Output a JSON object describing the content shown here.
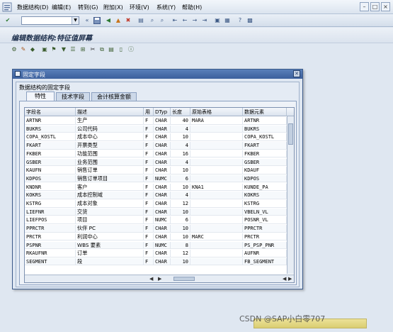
{
  "menubar": {
    "items": [
      "数据结构(D)",
      "编辑(E)",
      "转到(G)",
      "附加(X)",
      "环境(V)",
      "系统(Y)",
      "帮助(H)"
    ]
  },
  "page": {
    "title": "编辑数据结构:特征值屏幕"
  },
  "dialog": {
    "title": "固定字段",
    "group_label": "数据结构的固定字段",
    "tabs": [
      "特性",
      "技术字段",
      "会计核算金额"
    ],
    "table": {
      "headers": [
        "字段名",
        "描述",
        "用",
        "DTyp",
        "长度",
        "原始表格",
        "数据元素"
      ],
      "rows": [
        [
          "ARTNR",
          "生产",
          "F",
          "CHAR",
          "40",
          "MARA",
          "ARTNR"
        ],
        [
          "BUKRS",
          "公司代码",
          "F",
          "CHAR",
          "4",
          "",
          "BUKRS"
        ],
        [
          "COPA_KOSTL",
          "成本中心",
          "F",
          "CHAR",
          "10",
          "",
          "COPA_KOSTL"
        ],
        [
          "FKART",
          "开票类型",
          "F",
          "CHAR",
          "4",
          "",
          "FKART"
        ],
        [
          "FKBER",
          "功能范围",
          "F",
          "CHAR",
          "16",
          "",
          "FKBER"
        ],
        [
          "GSBER",
          "业务范围",
          "F",
          "CHAR",
          "4",
          "",
          "GSBER"
        ],
        [
          "KAUFN",
          "销售订单",
          "F",
          "CHAR",
          "10",
          "",
          "KDAUF"
        ],
        [
          "KDPOS",
          "销售订单项目",
          "F",
          "NUMC",
          "6",
          "",
          "KDPOS"
        ],
        [
          "KNDNR",
          "客户",
          "F",
          "CHAR",
          "10",
          "KNA1",
          "KUNDE_PA"
        ],
        [
          "KOKRS",
          "成本控制域",
          "F",
          "CHAR",
          "4",
          "",
          "KOKRS"
        ],
        [
          "KSTRG",
          "成本对象",
          "F",
          "CHAR",
          "12",
          "",
          "KSTRG"
        ],
        [
          "LIEFNR",
          "交货",
          "F",
          "CHAR",
          "10",
          "",
          "VBELN_VL"
        ],
        [
          "LIEFPOS",
          "项目",
          "F",
          "NUMC",
          "6",
          "",
          "POSNR_VL"
        ],
        [
          "PPRCTR",
          "伙伴 PC",
          "F",
          "CHAR",
          "10",
          "",
          "PPRCTR"
        ],
        [
          "PRCTR",
          "利润中心",
          "F",
          "CHAR",
          "10",
          "MARC",
          "PRCTR"
        ],
        [
          "PSPNR",
          "WBS 要素",
          "F",
          "NUMC",
          "8",
          "",
          "PS_PSP_PNR"
        ],
        [
          "RKAUFNR",
          "订单",
          "F",
          "CHAR",
          "12",
          "",
          "AUFNR"
        ],
        [
          "SEGMENT",
          "段",
          "F",
          "CHAR",
          "10",
          "",
          "FB_SEGMENT"
        ]
      ]
    }
  },
  "watermark": "CSDN @SAP小白零707",
  "icons": {
    "menu_logo": "sap-menu-icon",
    "save": "save-icon",
    "back": "back-icon",
    "exit": "exit-icon",
    "cancel": "cancel-icon",
    "print": "print-icon",
    "find": "find-icon",
    "help": "help-icon"
  }
}
